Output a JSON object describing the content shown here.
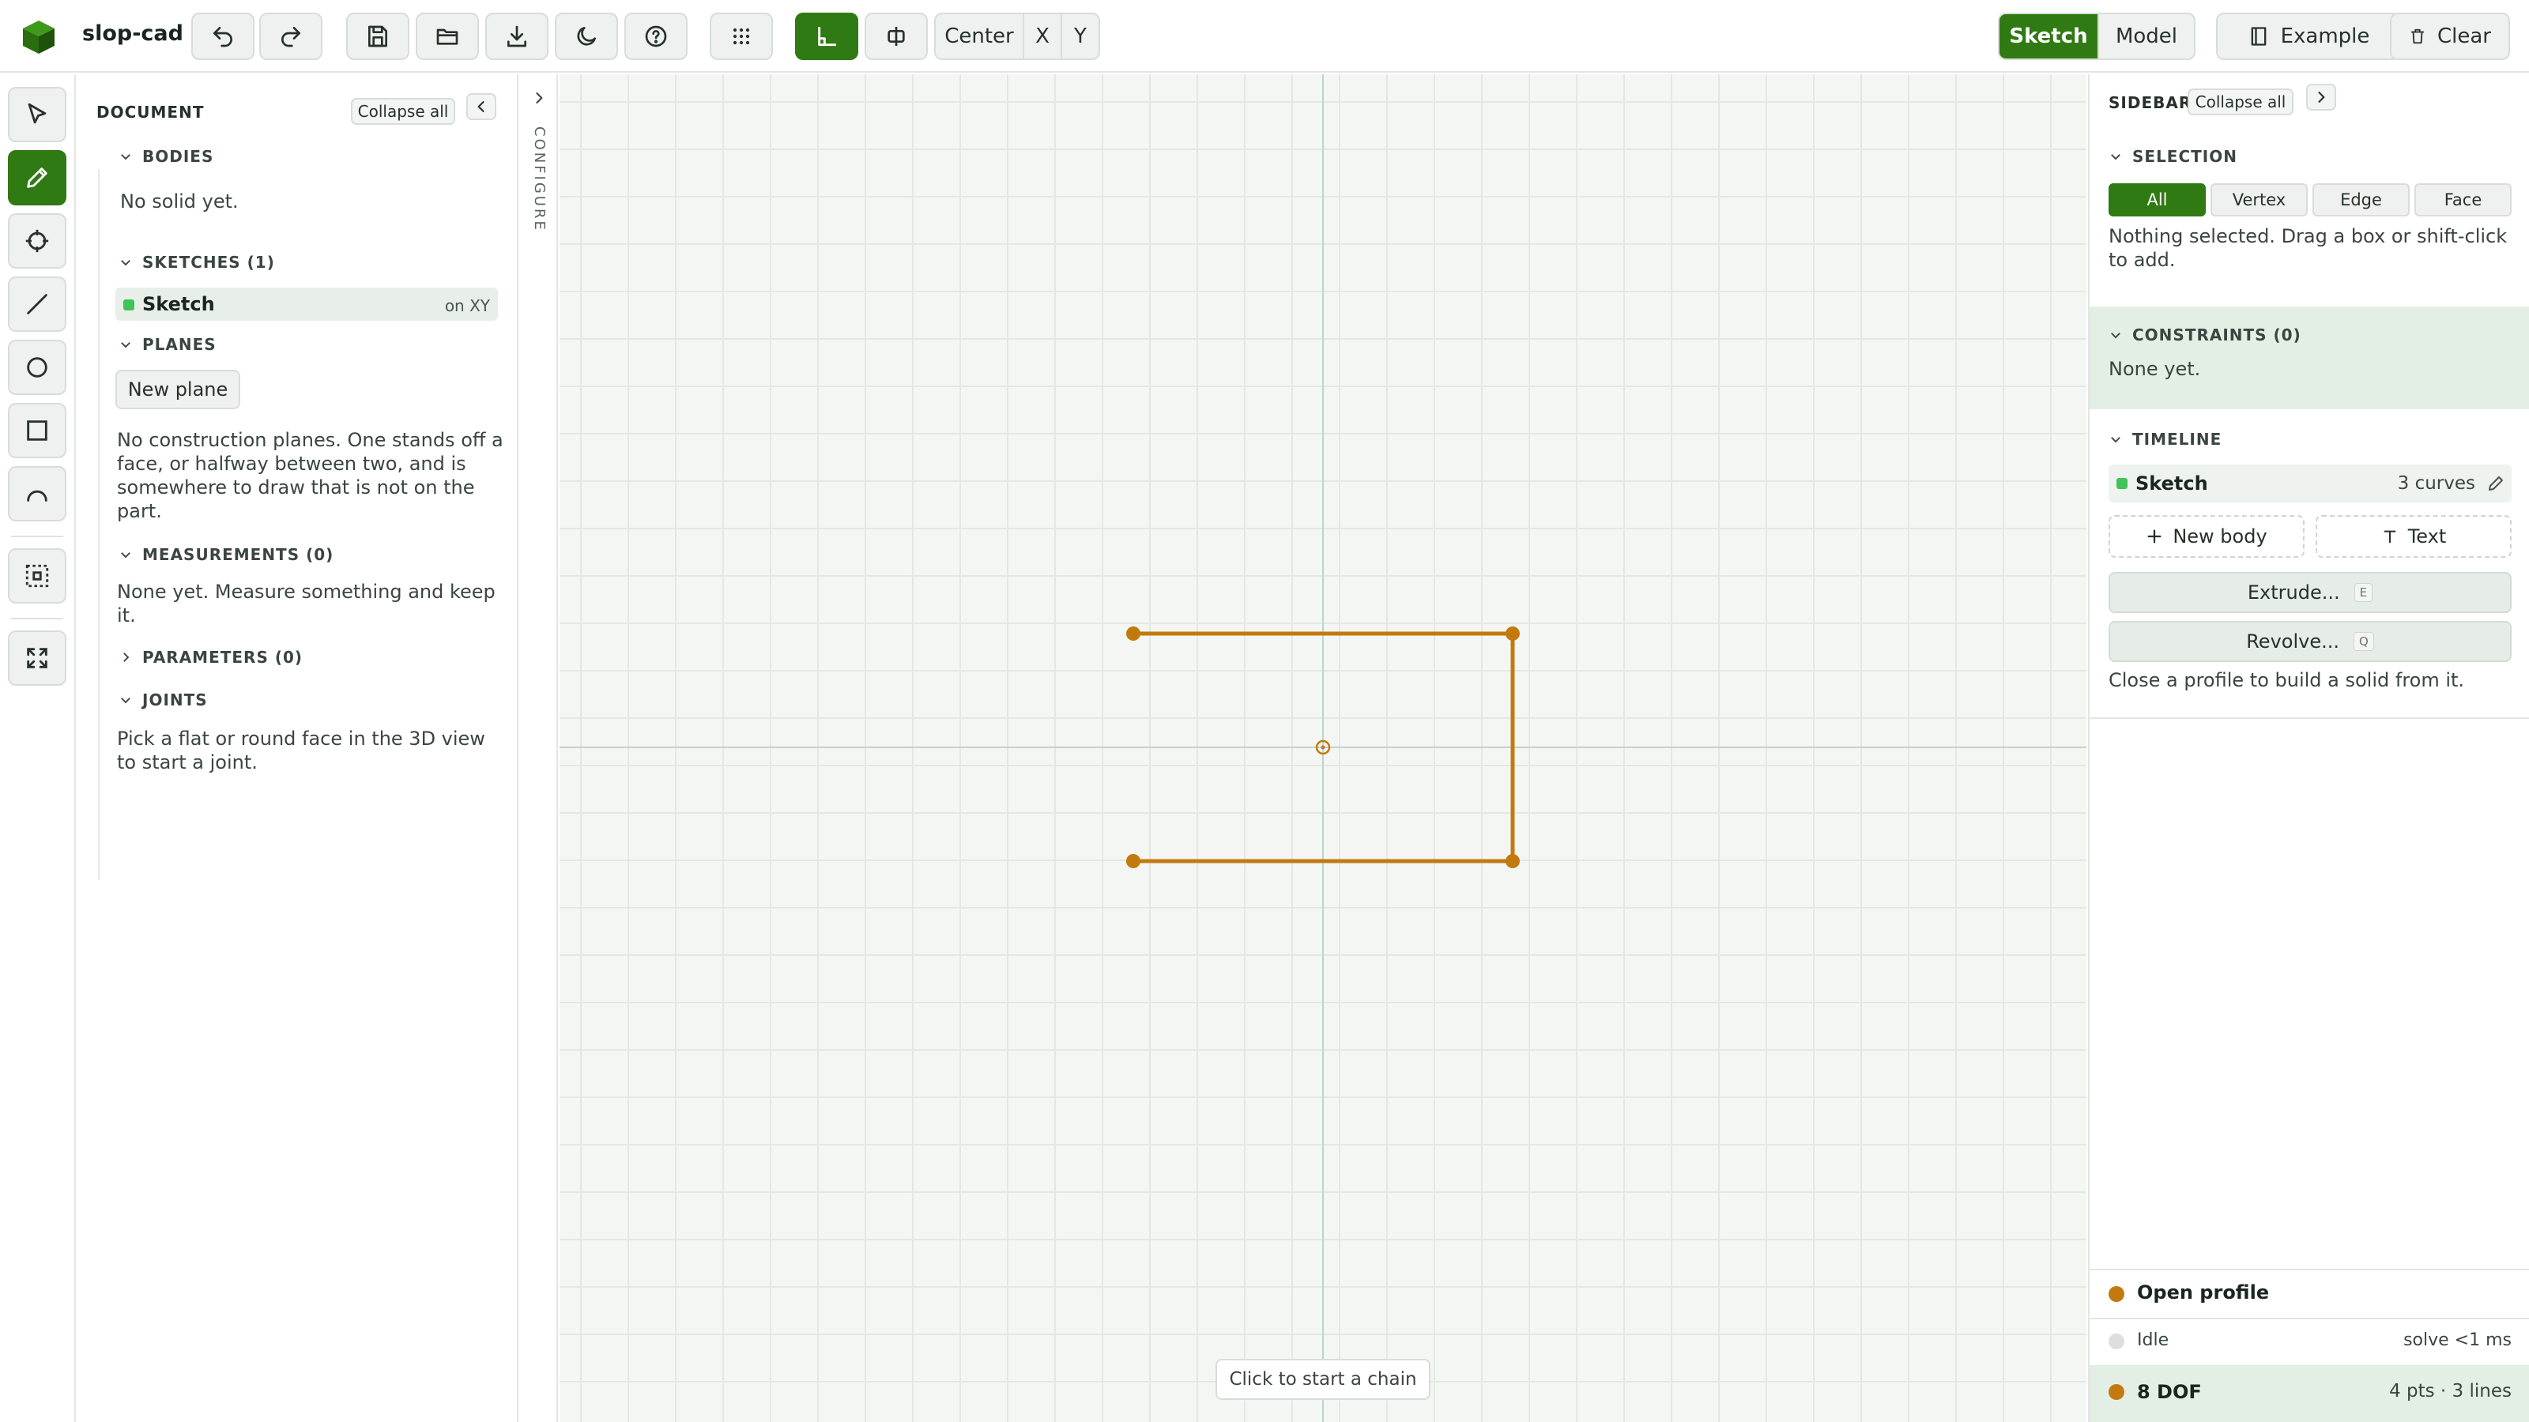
{
  "app": {
    "name": "slop-cad"
  },
  "toolbar": {
    "center_label": "Center",
    "axis_x": "X",
    "axis_y": "Y",
    "mode_sketch": "Sketch",
    "mode_model": "Model",
    "mode_selected": "Sketch",
    "example_label": "Example",
    "clear_label": "Clear"
  },
  "colors": {
    "accent": "#2f7a12",
    "sketch_line": "#c27a0e",
    "sketch_vertex": "#c27a0e",
    "status_green": "#3fc35a"
  },
  "document": {
    "title": "DOCUMENT",
    "collapse_label": "Collapse all",
    "bodies": {
      "title": "BODIES",
      "empty": "No solid yet."
    },
    "sketches": {
      "title": "SKETCHES (1)",
      "items": [
        {
          "name": "Sketch",
          "plane": "on XY"
        }
      ]
    },
    "planes": {
      "title": "PLANES",
      "new_plane_label": "New plane",
      "help": "No construction planes. One stands off a face, or halfway between two, and is somewhere to draw that is not on the part."
    },
    "measurements": {
      "title": "MEASUREMENTS (0)",
      "empty": "None yet. Measure something and keep it."
    },
    "parameters": {
      "title": "PARAMETERS (0)"
    },
    "joints": {
      "title": "JOINTS",
      "help": "Pick a flat or round face in the 3D view to start a joint."
    }
  },
  "configure": {
    "label": "CONFIGURE"
  },
  "canvas": {
    "hint": "Click to start a chain"
  },
  "sidebar": {
    "title": "SIDEBAR",
    "collapse_label": "Collapse all",
    "selection": {
      "title": "SELECTION",
      "filters": [
        "All",
        "Vertex",
        "Edge",
        "Face"
      ],
      "active_filter": "All",
      "message": "Nothing selected. Drag a box or shift-click to add."
    },
    "constraints": {
      "title": "CONSTRAINTS (0)",
      "empty": "None yet."
    },
    "timeline": {
      "title": "TIMELINE",
      "items": [
        {
          "name": "Sketch",
          "meta": "3 curves"
        }
      ],
      "new_body_label": "New body",
      "text_label": "Text",
      "extrude_label": "Extrude...",
      "extrude_key": "E",
      "revolve_label": "Revolve...",
      "revolve_key": "Q",
      "help": "Close a profile to build a solid from it."
    }
  },
  "status": {
    "profile": "Open profile",
    "solver_state": "Idle",
    "solver_time": "solve <1 ms",
    "dof": "8 DOF",
    "counts": "4 pts · 3 lines"
  }
}
